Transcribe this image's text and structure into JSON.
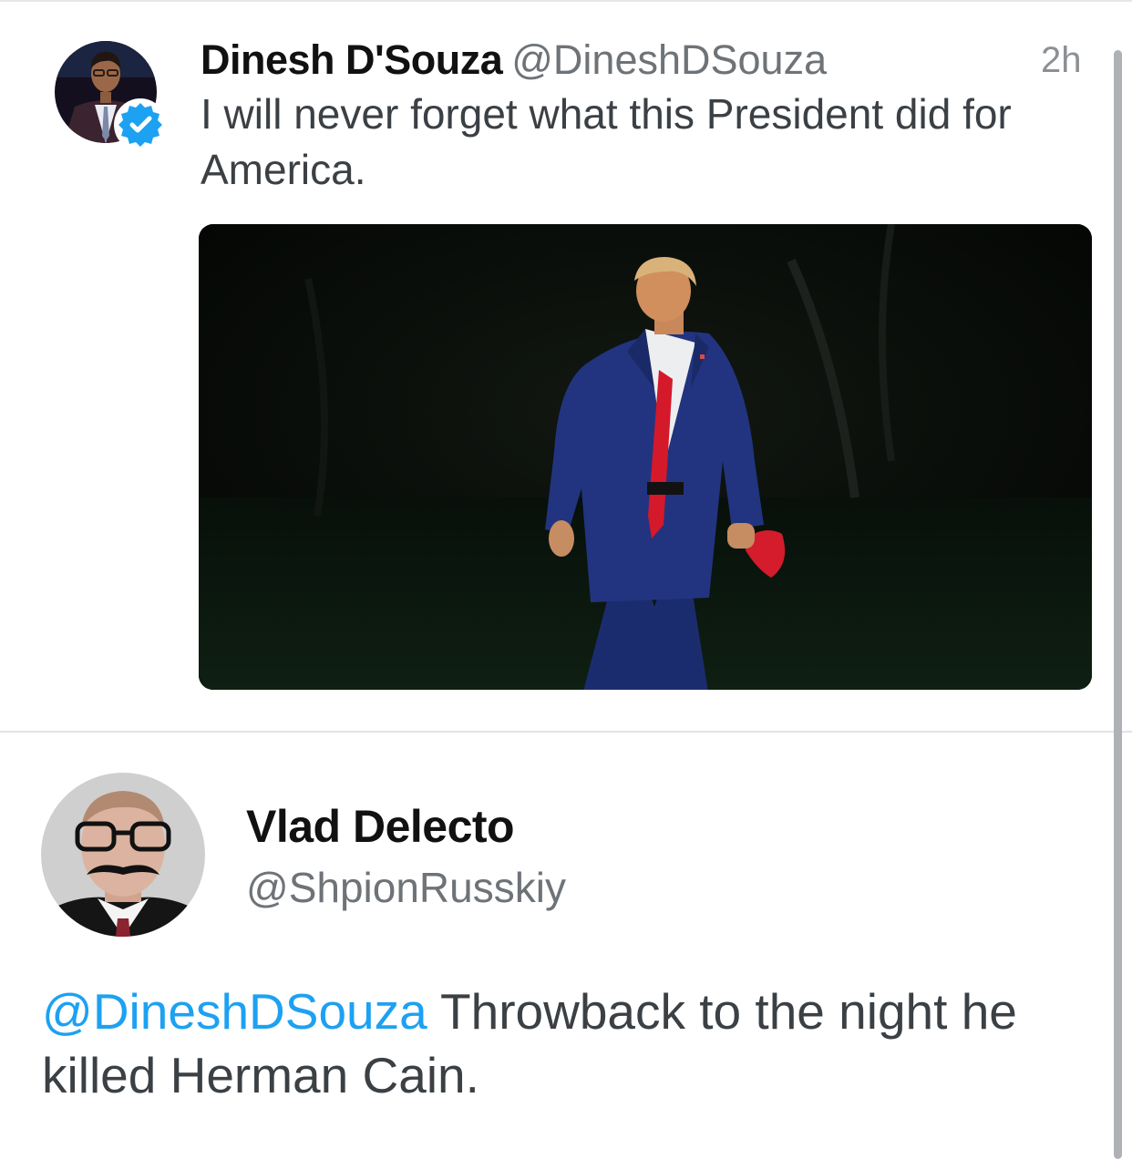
{
  "tweet": {
    "author_name": "Dinesh D'Souza",
    "author_handle": "@DineshDSouza",
    "time": "2h",
    "text": "I will never forget what this President did for America.",
    "verified_color": "#1da1f2"
  },
  "reply": {
    "author_name": "Vlad Delecto",
    "author_handle": "@ShpionRusskiy",
    "mention": "@DineshDSouza",
    "text": " Throwback to the night he killed Herman Cain.",
    "mention_color": "#1da1f2"
  }
}
